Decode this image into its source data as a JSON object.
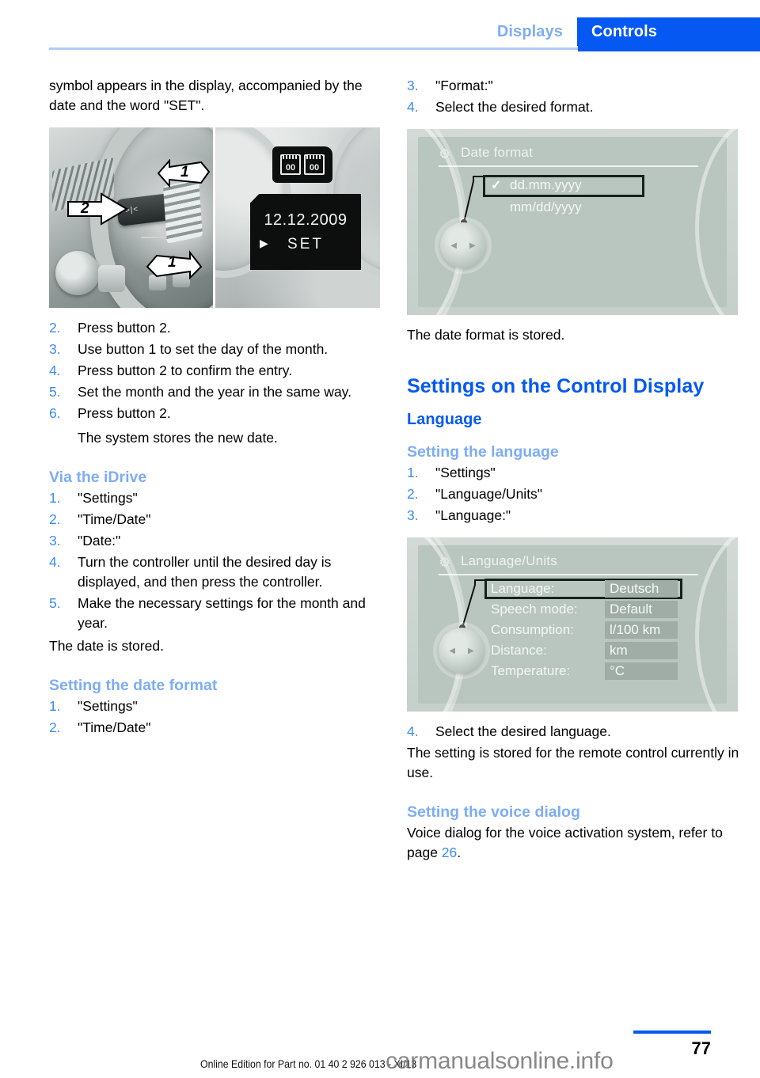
{
  "header": {
    "tab_inactive": "Displays",
    "tab_active": "Controls",
    "accent_blue": "#0559F2",
    "accent_light_blue": "#7EADF5"
  },
  "left_column": {
    "intro_paragraph": "symbol appears in the display, accompanied by the date and the word \"SET\".",
    "figure_dashboard": {
      "callout_1a": "1",
      "callout_1b": "1",
      "callout_2": "2",
      "cluster_date": "12.12.2009",
      "cluster_set": "SET",
      "cluster_icon_left": "00",
      "cluster_icon_right": "00"
    },
    "steps_manual": [
      {
        "num": "2.",
        "text": "Press button 2."
      },
      {
        "num": "3.",
        "text": "Use button 1 to set the day of the month."
      },
      {
        "num": "4.",
        "text": "Press button 2 to confirm the entry."
      },
      {
        "num": "5.",
        "text": "Set the month and the year in the same way."
      },
      {
        "num": "6.",
        "text": "Press button 2.",
        "sub": "The system stores the new date."
      }
    ],
    "idrive_heading": "Via the iDrive",
    "steps_idrive": [
      {
        "num": "1.",
        "text": "\"Settings\""
      },
      {
        "num": "2.",
        "text": "\"Time/Date\""
      },
      {
        "num": "3.",
        "text": "\"Date:\""
      },
      {
        "num": "4.",
        "text": "Turn the controller until the desired day is displayed, and then press the controller."
      },
      {
        "num": "5.",
        "text": "Make the necessary settings for the month and year."
      }
    ],
    "date_stored_note": "The date is stored.",
    "date_format_heading": "Setting the date format",
    "steps_date_format": [
      {
        "num": "1.",
        "text": "\"Settings\""
      },
      {
        "num": "2.",
        "text": "\"Time/Date\""
      }
    ]
  },
  "right_column": {
    "steps_date_format_cont": [
      {
        "num": "3.",
        "text": "\"Format:\""
      },
      {
        "num": "4.",
        "text": "Select the desired format."
      }
    ],
    "figure_date_format": {
      "title": "Date format",
      "gear_icon": "gear-icon",
      "options": [
        {
          "label": "dd.mm.yyyy",
          "checked": true
        },
        {
          "label": "mm/dd/yyyy",
          "checked": false
        }
      ]
    },
    "date_format_stored_note": "The date format is stored.",
    "chapter_heading": "Settings on the Control Display",
    "language_heading": "Language",
    "setting_language_heading": "Setting the language",
    "steps_language": [
      {
        "num": "1.",
        "text": "\"Settings\""
      },
      {
        "num": "2.",
        "text": "\"Language/Units\""
      },
      {
        "num": "3.",
        "text": "\"Language:\""
      }
    ],
    "figure_language_units": {
      "title": "Language/Units",
      "gear_icon": "gear-icon",
      "rows": [
        {
          "label": "Language:",
          "value": "Deutsch",
          "selected": true
        },
        {
          "label": "Speech mode:",
          "value": "Default",
          "selected": false
        },
        {
          "label": "Consumption:",
          "value": "l/100 km",
          "selected": false
        },
        {
          "label": "Distance:",
          "value": "km",
          "selected": false
        },
        {
          "label": "Temperature:",
          "value": "°C",
          "selected": false
        }
      ]
    },
    "step_select_language": {
      "num": "4.",
      "text": "Select the desired language."
    },
    "stored_remote_note": "The setting is stored for the remote control currently in use.",
    "voice_dialog_heading": "Setting the voice dialog",
    "voice_dialog_text_before": "Voice dialog for the voice activation system, refer to page ",
    "voice_dialog_page": "26",
    "voice_dialog_text_after": "."
  },
  "footer": {
    "page_number": "77",
    "online_edition": "Online Edition for Part no. 01 40 2 926 013 - XI/13",
    "watermark": "carmanualsonline.info"
  }
}
